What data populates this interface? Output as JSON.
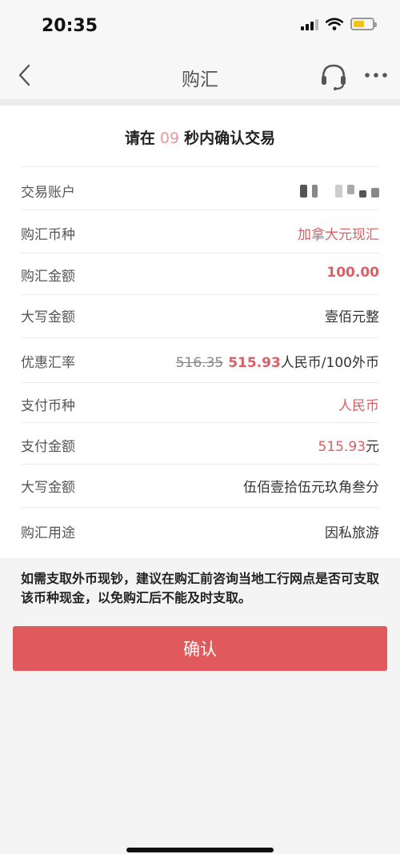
{
  "status_bar": {
    "time": "20:35"
  },
  "nav": {
    "title": "购汇",
    "back_icon": "chevron-left-icon",
    "service_icon": "headset-icon",
    "more_icon": "more-dots-icon"
  },
  "countdown": {
    "prefix": "请在",
    "seconds": "09",
    "suffix": "秒内确认交易"
  },
  "details": {
    "account": {
      "label": "交易账户"
    },
    "currency": {
      "label": "购汇币种",
      "value": "加拿大元现汇"
    },
    "amount": {
      "label": "购汇金额",
      "value": "100.00"
    },
    "amount_words": {
      "label": "大写金额",
      "value": "壹佰元整"
    },
    "rate": {
      "label": "优惠汇率",
      "old": "516.35",
      "new": "515.93",
      "unit": "人民币/100外币"
    },
    "pay_currency": {
      "label": "支付币种",
      "value": "人民币"
    },
    "pay_amount": {
      "label": "支付金额",
      "value": "515.93",
      "unit": "元"
    },
    "pay_amount_words": {
      "label": "大写金额",
      "value": "伍佰壹拾伍元玖角叁分"
    },
    "purpose": {
      "label": "购汇用途",
      "value": "因私旅游"
    }
  },
  "notice": "如需支取外币现钞，建议在购汇前咨询当地工行网点是否可支取该币种现金，以免购汇后不能及时支取。",
  "confirm_label": "确认",
  "colors": {
    "accent": "#e05a5d",
    "value_red": "#d96064",
    "countdown": "#e6989a"
  }
}
